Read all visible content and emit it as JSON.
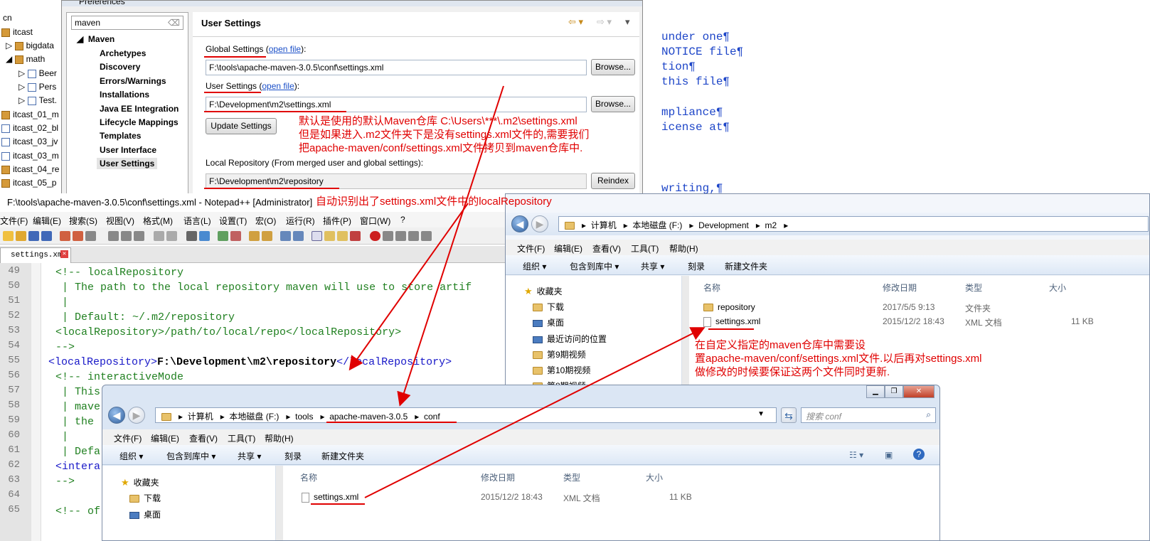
{
  "bg_editor": {
    "lines": [
      "under one¶",
      "NOTICE file¶",
      "tion¶",
      "this file¶",
      "",
      "mpliance¶",
      "icense at¶",
      "",
      "",
      "",
      "writing,¶"
    ]
  },
  "project_tree": {
    "items": [
      {
        "label": "cn"
      },
      {
        "label": "itcast"
      },
      {
        "label": "bigdata"
      },
      {
        "label": "math"
      },
      {
        "label": "Beer"
      },
      {
        "label": "Pers"
      },
      {
        "label": "Test."
      },
      {
        "label": "itcast_01_m"
      },
      {
        "label": "itcast_02_bl"
      },
      {
        "label": "itcast_03_jv"
      },
      {
        "label": "itcast_03_m"
      },
      {
        "label": "itcast_04_re"
      },
      {
        "label": "itcast_05_p"
      }
    ]
  },
  "preferences": {
    "window_title": "Preferences",
    "filter_value": "maven",
    "tree_root": "Maven",
    "tree_items": [
      "Archetypes",
      "Discovery",
      "Errors/Warnings",
      "Installations",
      "Java EE Integration",
      "Lifecycle Mappings",
      "Templates",
      "User Interface",
      "User Settings"
    ],
    "page_title": "User Settings",
    "global_label": "Global Settings",
    "user_label": "User Settings",
    "open_file": "open file",
    "global_value": "F:\\tools\\apache-maven-3.0.5\\conf\\settings.xml",
    "user_value": "F:\\Development\\m2\\settings.xml",
    "browse": "Browse...",
    "update": "Update Settings",
    "local_repo_label": "Local Repository (From merged user and global settings):",
    "local_repo_value": "F:\\Development\\m2\\repository",
    "reindex": "Reindex"
  },
  "notepad": {
    "title": "F:\\tools\\apache-maven-3.0.5\\conf\\settings.xml - Notepad++ [Administrator]",
    "menu": [
      "文件(F)",
      "编辑(E)",
      "搜索(S)",
      "视图(V)",
      "格式(M)",
      "语言(L)",
      "设置(T)",
      "宏(O)",
      "运行(R)",
      "插件(P)",
      "窗口(W)",
      "?"
    ],
    "tab": "settings.xml",
    "line_numbers": [
      "49",
      "50",
      "51",
      "52",
      "53",
      "54",
      "55",
      "56",
      "57",
      "58",
      "59",
      "60",
      "61",
      "62",
      "63",
      "64",
      "65"
    ],
    "code": {
      "l49": "<!-- localRepository",
      "l50": " | The path to the local repository maven will use to store artif",
      "l51": " |",
      "l52": " | Default: ~/.m2/repository",
      "l53": "<localRepository>/path/to/local/repo</localRepository>",
      "l54": "-->",
      "l55_open": "<localRepository>",
      "l55_value": "F:\\Development\\m2\\repository",
      "l55_close": "</localRepository>",
      "l56": "<!-- interactiveMode",
      "l57": " | This",
      "l58": " | mave",
      "l59": " | the",
      "l60": " |",
      "l61": " | Defa",
      "l62": "<intera",
      "l63": "-->",
      "l64": "",
      "l65": "<!-- of"
    }
  },
  "explorer_m2": {
    "path": [
      "计算机",
      "本地磁盘 (F:)",
      "Development",
      "m2"
    ],
    "menu": [
      "文件(F)",
      "编辑(E)",
      "查看(V)",
      "工具(T)",
      "帮助(H)"
    ],
    "commands": [
      "组织 ▾",
      "包含到库中 ▾",
      "共享 ▾",
      "刻录",
      "新建文件夹"
    ],
    "nav": [
      "收藏夹",
      "下载",
      "桌面",
      "最近访问的位置",
      "第9期视频",
      "第10期视频",
      "第8期视频"
    ],
    "columns": [
      "名称",
      "修改日期",
      "类型",
      "大小"
    ],
    "rows": [
      {
        "name": "repository",
        "date": "2017/5/5 9:13",
        "type": "文件夹",
        "size": ""
      },
      {
        "name": "settings.xml",
        "date": "2015/12/2 18:43",
        "type": "XML 文档",
        "size": "11 KB"
      }
    ]
  },
  "explorer_conf": {
    "path": [
      "计算机",
      "本地磁盘 (F:)",
      "tools",
      "apache-maven-3.0.5",
      "conf"
    ],
    "search_placeholder": "搜索 conf",
    "menu": [
      "文件(F)",
      "编辑(E)",
      "查看(V)",
      "工具(T)",
      "帮助(H)"
    ],
    "commands": [
      "组织 ▾",
      "包含到库中 ▾",
      "共享 ▾",
      "刻录",
      "新建文件夹"
    ],
    "nav": [
      "收藏夹",
      "下载",
      "桌面"
    ],
    "columns": [
      "名称",
      "修改日期",
      "类型",
      "大小"
    ],
    "rows": [
      {
        "name": "settings.xml",
        "date": "2015/12/2 18:43",
        "type": "XML 文档",
        "size": "11 KB"
      }
    ]
  },
  "annotations": {
    "a1_line1": "默认是使用的默认Maven仓库 C:\\Users\\***\\.m2\\settings.xml",
    "a1_line2": "但是如果进入.m2文件夹下是没有settings.xml文件的,需要我们",
    "a1_line3": "把apache-maven/conf/settings.xml文件拷贝到maven仓库中.",
    "a2": "自动识别出了settings.xml文件中的localRepository",
    "a3_line1": "在自定义指定的maven仓库中需要设",
    "a3_line2": "置apache-maven/conf/settings.xml文件.以后再对settings.xml",
    "a3_line3": "做修改的时候要保证这两个文件同时更新."
  },
  "colors": {
    "annotation": "#e00000",
    "link": "#1a4fc8",
    "xml_tag": "#1818c8",
    "xml_comment": "#208020"
  }
}
